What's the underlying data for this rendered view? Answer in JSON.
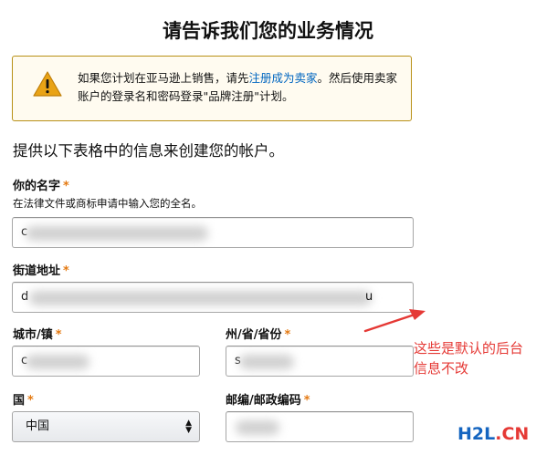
{
  "header": {
    "title": "请告诉我们您的业务情况"
  },
  "alert": {
    "icon": "warning-icon",
    "text_before": "如果您计划在亚马逊上销售，请先",
    "link": "注册成为卖家",
    "text_after": "。然后使用卖家账户的登录名和密码登录\"品牌注册\"计划。"
  },
  "intro": "提供以下表格中的信息来创建您的帐户。",
  "form": {
    "required_mark": "*",
    "name": {
      "label": "你的名字",
      "hint": "在法律文件或商标申请中输入您的全名。",
      "value_visible": "c"
    },
    "street": {
      "label": "街道地址",
      "value_visible": "d",
      "value_tail": "u"
    },
    "city": {
      "label": "城市/镇",
      "value_visible": "c"
    },
    "state": {
      "label": "州/省/省份",
      "value_visible": "s"
    },
    "country": {
      "label": "国",
      "selected": "中国"
    },
    "postal": {
      "label": "邮编/邮政编码",
      "value_visible": ""
    }
  },
  "annotation": {
    "text": "这些是默认的后台信息不改",
    "color": "#e53935"
  },
  "watermark": {
    "text_a": "H2L",
    "text_b": ".CN"
  },
  "colors": {
    "accent_link": "#0066c0",
    "required": "#e47911",
    "alert_border": "#b89016",
    "alert_bg": "#fffbf0"
  }
}
